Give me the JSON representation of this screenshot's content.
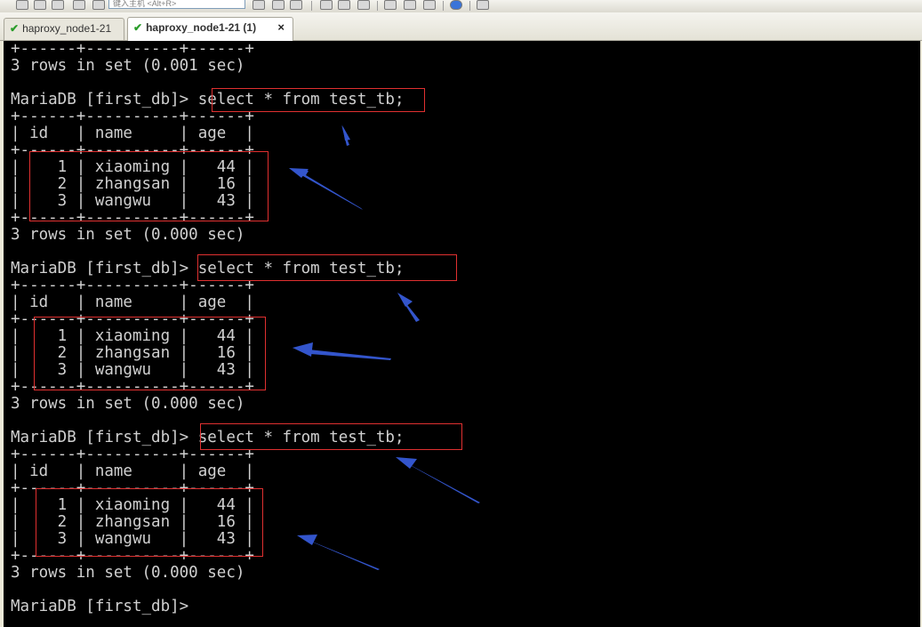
{
  "toolbar": {
    "search_placeholder": "键入主机 <Alt+R>",
    "icons": [
      "new-session-icon",
      "reconnect-icon",
      "disconnect-icon",
      "key-icon",
      "copy-icon",
      "paste-icon",
      "find-icon",
      "print-icon",
      "settings-icon",
      "filter-icon",
      "font-icon",
      "help-icon",
      "sftp-icon"
    ]
  },
  "tabs": [
    {
      "label": "haproxy_node1-21",
      "active": false
    },
    {
      "label": "haproxy_node1-21 (1)",
      "active": true,
      "close": "×"
    }
  ],
  "terminal": {
    "lines": [
      "+------+----------+------+",
      "3 rows in set (0.001 sec)",
      "",
      "MariaDB [first_db]> select * from test_tb;",
      "+------+----------+------+",
      "| id   | name     | age  |",
      "+------+----------+------+",
      "|    1 | xiaoming |   44 |",
      "|    2 | zhangsan |   16 |",
      "|    3 | wangwu   |   43 |",
      "+------+----------+------+",
      "3 rows in set (0.000 sec)",
      "",
      "MariaDB [first_db]> select * from test_tb;",
      "+------+----------+------+",
      "| id   | name     | age  |",
      "+------+----------+------+",
      "|    1 | xiaoming |   44 |",
      "|    2 | zhangsan |   16 |",
      "|    3 | wangwu   |   43 |",
      "+------+----------+------+",
      "3 rows in set (0.000 sec)",
      "",
      "MariaDB [first_db]> select * from test_tb;",
      "+------+----------+------+",
      "| id   | name     | age  |",
      "+------+----------+------+",
      "|    1 | xiaoming |   44 |",
      "|    2 | zhangsan |   16 |",
      "|    3 | wangwu   |   43 |",
      "+------+----------+------+",
      "3 rows in set (0.000 sec)",
      "",
      "MariaDB [first_db]>"
    ],
    "colors": {
      "background": "#000000",
      "text": "#d0d0d0",
      "highlight_box": "#e03030",
      "arrow": "#3355cc"
    }
  }
}
